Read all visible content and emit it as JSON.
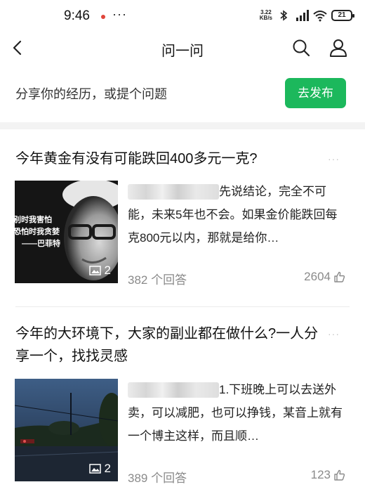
{
  "status_bar": {
    "time": "9:46",
    "more": "···",
    "net_speed_value": "3.22",
    "net_speed_unit": "KB/s",
    "battery": "21",
    "icons": [
      "bluetooth-icon",
      "signal-icon",
      "wifi-icon",
      "battery-icon"
    ]
  },
  "nav": {
    "title": "问一问",
    "icons": [
      "back-arrow-icon",
      "search-icon",
      "user-icon"
    ]
  },
  "share": {
    "prompt": "分享你的经历，或提个问题",
    "publish_label": "去发布",
    "accent_color": "#1cb85c"
  },
  "feed": [
    {
      "title": "今年黄金有没有可能跌回400多元一克?",
      "more": "···",
      "thumbnail": {
        "overlay_line1": "别时我害怕",
        "overlay_line2": "恐怕时我贪婪",
        "overlay_line3": "——巴菲特",
        "image_count": "2"
      },
      "excerpt": "先说结论，完全不可能，未来5年也不会。如果金价能跌回每克800元以内，那就是给你…",
      "answers": "382 个回答",
      "likes": "2604"
    },
    {
      "title": "今年的大环境下，大家的副业都在做什么?一人分享一个，找找灵感",
      "more": "···",
      "thumbnail": {
        "image_count": "2"
      },
      "excerpt": "1.下班晚上可以去送外卖，可以减肥，也可以挣钱，某音上就有一个博主这样，而且顺…",
      "answers": "389 个回答",
      "likes": "123"
    }
  ]
}
